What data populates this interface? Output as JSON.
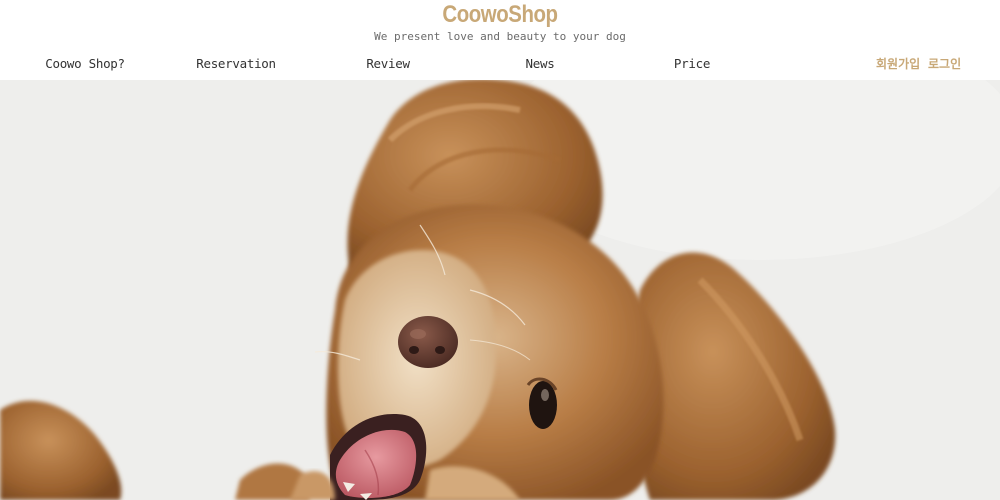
{
  "header": {
    "logo": "CoowoShop",
    "tagline": "We present love and beauty to your dog"
  },
  "nav": {
    "items": [
      {
        "label": "Coowo Shop?"
      },
      {
        "label": "Reservation"
      },
      {
        "label": "Review"
      },
      {
        "label": "News"
      },
      {
        "label": "Price"
      }
    ]
  },
  "auth": {
    "signup": "회원가입",
    "login": "로그인"
  },
  "hero": {
    "image": "dog-photo"
  },
  "colors": {
    "brand": "#c8a877",
    "nav_text": "#333333",
    "tagline": "#6b6b6b",
    "hero_bg": "#eeeeec"
  }
}
